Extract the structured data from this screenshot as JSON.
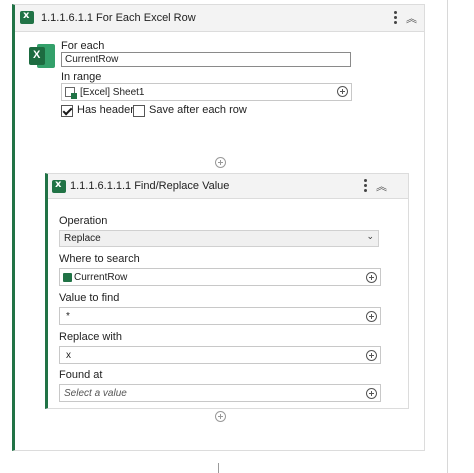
{
  "outer": {
    "title": "1.1.1.6.1.1  For Each Excel Row",
    "for_each_label": "For each",
    "for_each_value": "CurrentRow",
    "in_range_label": "In range",
    "in_range_value": "[Excel] Sheet1",
    "has_headers_label": "Has headers",
    "has_headers_checked": true,
    "save_after_label": "Save after each row",
    "save_after_checked": false
  },
  "inner": {
    "title": "1.1.1.6.1.1.1  Find/Replace Value",
    "operation_label": "Operation",
    "operation_value": "Replace",
    "where_label": "Where to search",
    "where_value": "CurrentRow",
    "value_label": "Value to find",
    "value_value": "*",
    "replace_label": "Replace with",
    "replace_value": "x",
    "found_label": "Found at",
    "found_placeholder": "Select a value"
  },
  "colors": {
    "accent": "#217346",
    "header_bg": "#f3f3f3"
  },
  "icons": [
    "excel-icon",
    "more-options-icon",
    "collapse-icon",
    "add-circle-icon",
    "checkbox",
    "chevron-down-icon",
    "range-icon"
  ]
}
